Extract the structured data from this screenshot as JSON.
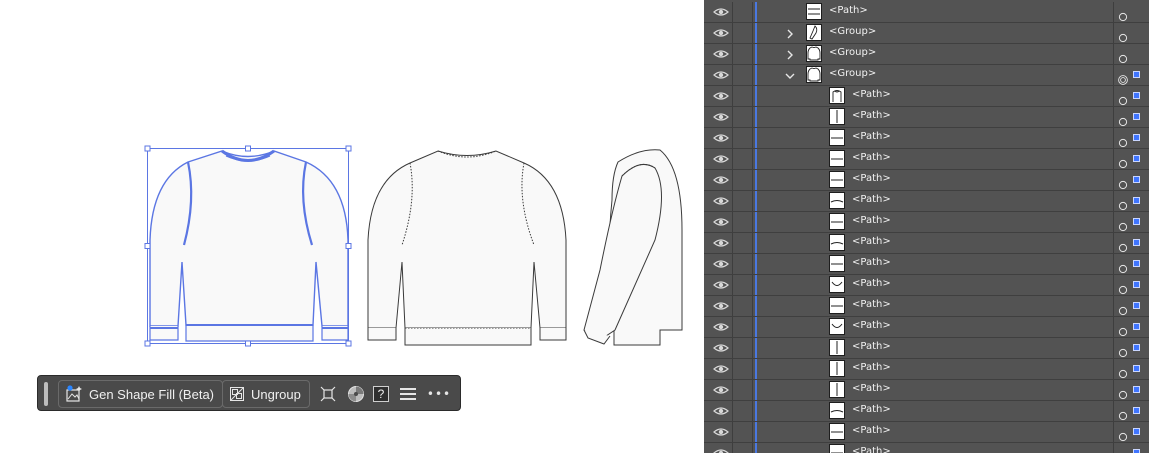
{
  "taskbar": {
    "gen_shape_fill_label": "Gen Shape Fill (Beta)",
    "ungroup_label": "Ungroup",
    "help_label": "?",
    "more_label": "•••"
  },
  "layers": {
    "rows": [
      {
        "name": "<Path>",
        "indent": 0,
        "expander": "none",
        "thumb": "hlines",
        "target": "ring",
        "selected": false
      },
      {
        "name": "<Group>",
        "indent": 0,
        "expander": "collapsed",
        "thumb": "sleeve",
        "target": "ring",
        "selected": false
      },
      {
        "name": "<Group>",
        "indent": 0,
        "expander": "collapsed",
        "thumb": "sweater",
        "target": "ring",
        "selected": false
      },
      {
        "name": "<Group>",
        "indent": 0,
        "expander": "expanded",
        "thumb": "sweater",
        "target": "double-ring",
        "selected": true
      },
      {
        "name": "<Path>",
        "indent": 1,
        "expander": "none",
        "thumb": "collar",
        "target": "ring",
        "selected": true
      },
      {
        "name": "<Path>",
        "indent": 1,
        "expander": "none",
        "thumb": "vline",
        "target": "ring",
        "selected": true
      },
      {
        "name": "<Path>",
        "indent": 1,
        "expander": "none",
        "thumb": "hline",
        "target": "ring",
        "selected": true
      },
      {
        "name": "<Path>",
        "indent": 1,
        "expander": "none",
        "thumb": "hline",
        "target": "ring",
        "selected": true
      },
      {
        "name": "<Path>",
        "indent": 1,
        "expander": "none",
        "thumb": "hline",
        "target": "ring",
        "selected": true
      },
      {
        "name": "<Path>",
        "indent": 1,
        "expander": "none",
        "thumb": "curve",
        "target": "ring",
        "selected": true
      },
      {
        "name": "<Path>",
        "indent": 1,
        "expander": "none",
        "thumb": "hline",
        "target": "ring",
        "selected": true
      },
      {
        "name": "<Path>",
        "indent": 1,
        "expander": "none",
        "thumb": "curve",
        "target": "ring",
        "selected": true
      },
      {
        "name": "<Path>",
        "indent": 1,
        "expander": "none",
        "thumb": "hline",
        "target": "ring",
        "selected": true
      },
      {
        "name": "<Path>",
        "indent": 1,
        "expander": "none",
        "thumb": "arc",
        "target": "ring",
        "selected": true
      },
      {
        "name": "<Path>",
        "indent": 1,
        "expander": "none",
        "thumb": "hline",
        "target": "ring",
        "selected": true
      },
      {
        "name": "<Path>",
        "indent": 1,
        "expander": "none",
        "thumb": "arc",
        "target": "ring",
        "selected": true
      },
      {
        "name": "<Path>",
        "indent": 1,
        "expander": "none",
        "thumb": "vline",
        "target": "ring",
        "selected": true
      },
      {
        "name": "<Path>",
        "indent": 1,
        "expander": "none",
        "thumb": "vline",
        "target": "ring",
        "selected": true
      },
      {
        "name": "<Path>",
        "indent": 1,
        "expander": "none",
        "thumb": "vline",
        "target": "ring",
        "selected": true
      },
      {
        "name": "<Path>",
        "indent": 1,
        "expander": "none",
        "thumb": "curve",
        "target": "ring",
        "selected": true
      },
      {
        "name": "<Path>",
        "indent": 1,
        "expander": "none",
        "thumb": "hline",
        "target": "ring",
        "selected": true
      },
      {
        "name": "<Path>",
        "indent": 1,
        "expander": "none",
        "thumb": "hline",
        "target": "ring",
        "selected": true
      }
    ]
  },
  "colors": {
    "panel_bg": "#535353",
    "layer_color": "#4a78e0",
    "selection_blue": "#3f75ff",
    "taskbar_bg": "#4a4a4a"
  }
}
